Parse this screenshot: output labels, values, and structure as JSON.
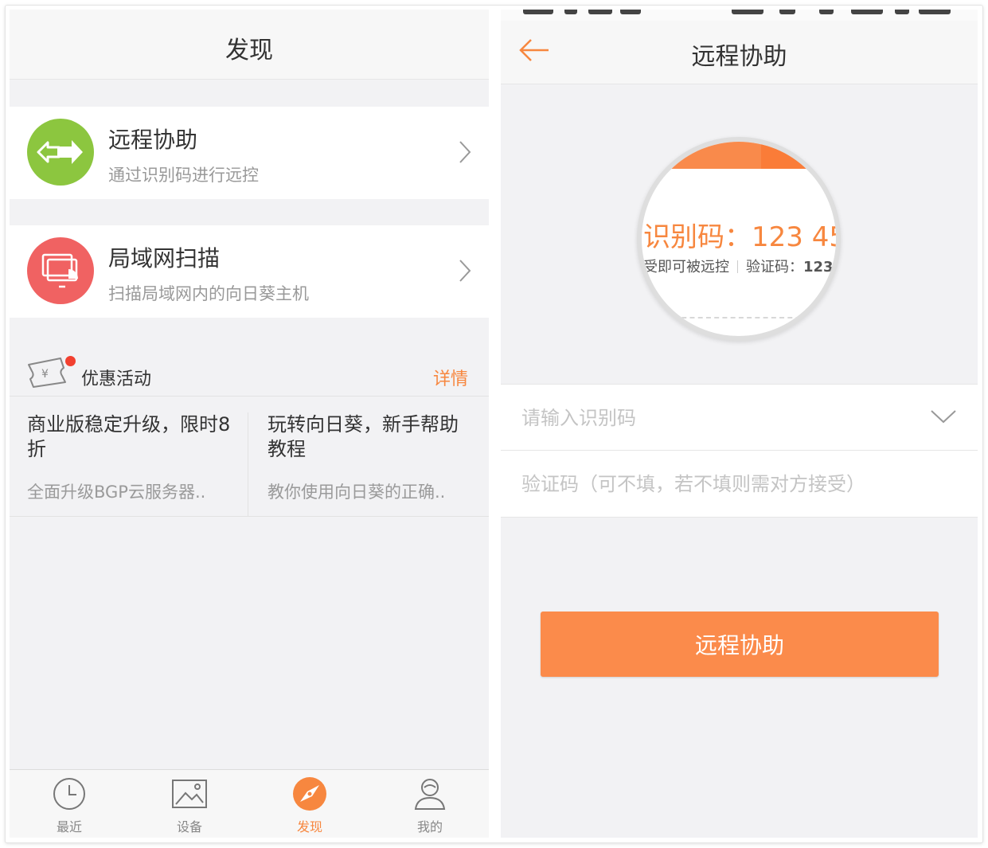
{
  "discover": {
    "title": "发现",
    "items": [
      {
        "title": "远程协助",
        "subtitle": "通过识别码进行远控",
        "icon": "remote-assist-icon",
        "color": "#8cc63f"
      },
      {
        "title": "局域网扫描",
        "subtitle": "扫描局域网内的向日葵主机",
        "icon": "lan-scan-icon",
        "color": "#f06262"
      }
    ],
    "promo": {
      "title": "优惠活动",
      "detail_link": "详情",
      "cards": [
        {
          "title": "商业版稳定升级，限时8折",
          "summary": "全面升级BGP云服务器.."
        },
        {
          "title": "玩转向日葵，新手帮助教程",
          "summary": "教你使用向日葵的正确.."
        }
      ]
    },
    "tabs": [
      {
        "label": "最近",
        "icon": "clock-icon",
        "active": false
      },
      {
        "label": "设备",
        "icon": "device-image-icon",
        "active": false
      },
      {
        "label": "发现",
        "icon": "compass-icon",
        "active": true
      },
      {
        "label": "我的",
        "icon": "user-icon",
        "active": false
      }
    ]
  },
  "remote": {
    "title": "远程协助",
    "illustration": {
      "code_line": "识别码：123 45",
      "sub_line_left": "受即可被远控",
      "sub_line_right_label": "验证码：",
      "sub_line_right_value": "123"
    },
    "code_input": {
      "placeholder": "请输入识别码",
      "value": ""
    },
    "verify_input": {
      "placeholder": "验证码（可不填，若不填则需对方接受）",
      "value": ""
    },
    "submit_label": "远程协助"
  },
  "colors": {
    "accent": "#f7873f",
    "button": "#fb8b4b",
    "green": "#8cc63f",
    "red": "#f06262"
  }
}
